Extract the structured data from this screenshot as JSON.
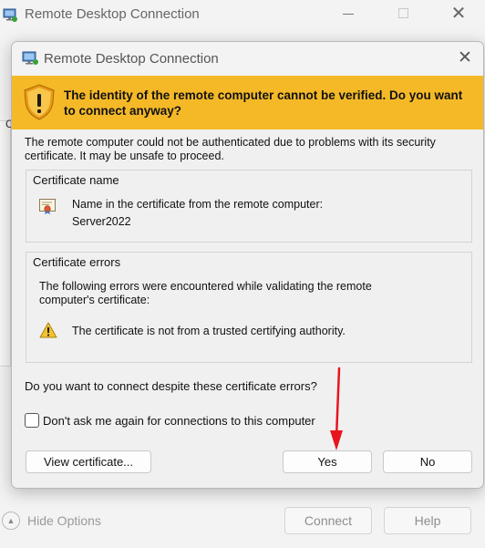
{
  "background_window": {
    "title": "Remote Desktop Connection",
    "hide_options_label": "Hide Options",
    "connect_label": "Connect",
    "help_label": "Help",
    "partial_char": "C"
  },
  "dialog": {
    "title": "Remote Desktop Connection",
    "warning_banner": "The identity of the remote computer cannot be verified. Do you want to connect anyway?",
    "description": "The remote computer could not be authenticated due to problems with its security certificate. It may be unsafe to proceed.",
    "certificate_name": {
      "group_title": "Certificate name",
      "label": "Name in the certificate from the remote computer:",
      "value": "Server2022"
    },
    "certificate_errors": {
      "group_title": "Certificate errors",
      "description": "The following errors were encountered while validating the remote computer's certificate:",
      "error": "The certificate is not from a trusted certifying authority."
    },
    "question": "Do you want to connect despite these certificate errors?",
    "checkbox_label": "Don't ask me again for connections to this computer",
    "checkbox_checked": false,
    "buttons": {
      "view_certificate": "View certificate...",
      "yes": "Yes",
      "no": "No"
    }
  },
  "icons": {
    "app": "remote-desktop-icon",
    "banner": "warning-shield-icon",
    "certificate": "certificate-icon",
    "error": "warning-triangle-icon",
    "close": "close-icon",
    "annotation": "red-arrow-icon"
  },
  "colors": {
    "banner": "#f5b928",
    "annotation_arrow": "#e8141c"
  }
}
